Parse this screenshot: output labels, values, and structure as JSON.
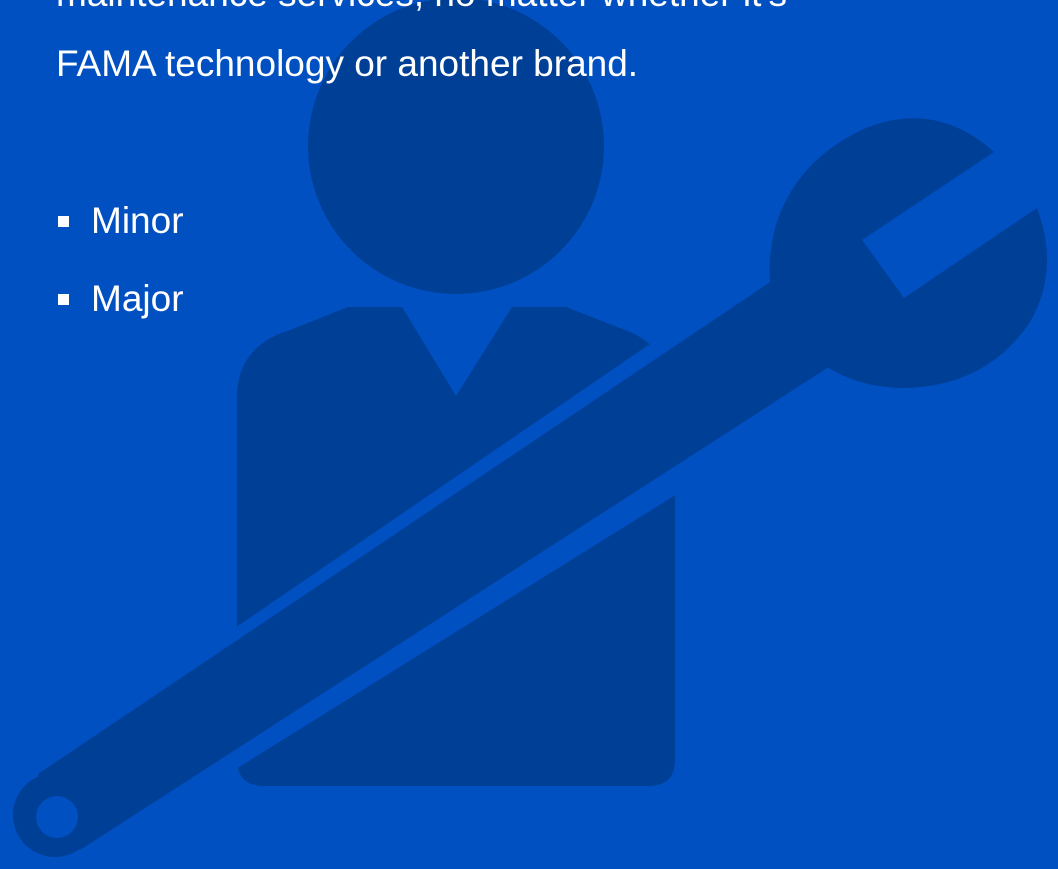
{
  "intro": {
    "line1": "maintenance services, no matter whether it's",
    "line2": "FAMA technology or another brand."
  },
  "list": {
    "items": [
      "Minor",
      "Major"
    ]
  },
  "colors": {
    "background": "#0050c2",
    "illustration": "#003f96",
    "text": "#ffffff"
  },
  "icons": {
    "illustration": "technician-with-wrench-icon"
  }
}
